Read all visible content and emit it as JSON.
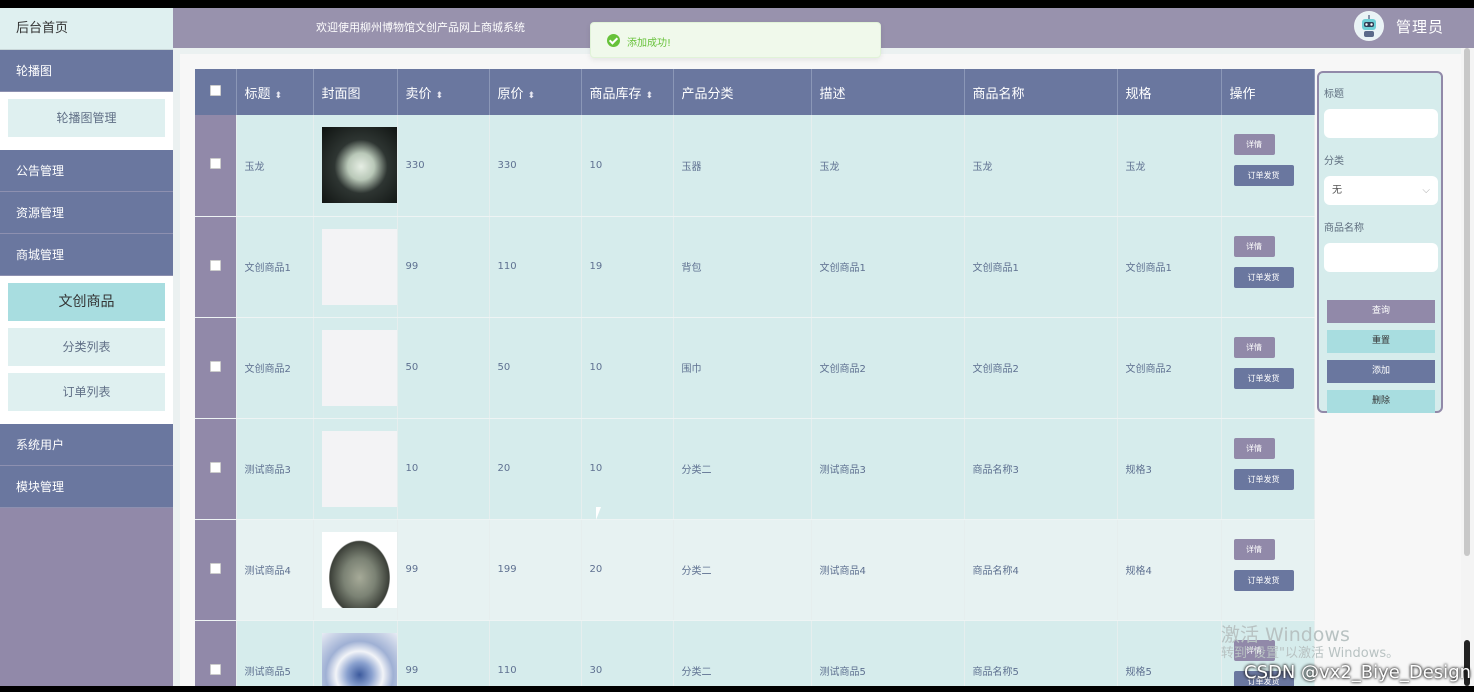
{
  "sidebar": {
    "home": "后台首页",
    "menu1": "轮播图",
    "sub1": [
      "轮播图管理"
    ],
    "menu2": "公告管理",
    "menu3": "资源管理",
    "menu4": "商城管理",
    "sub4": [
      "文创商品",
      "分类列表",
      "订单列表"
    ],
    "menu5": "系统用户",
    "menu6": "模块管理"
  },
  "header": {
    "welcome": "欢迎使用柳州博物馆文创产品网上商城系统",
    "admin": "管理员"
  },
  "toast": {
    "message": "添加成功!"
  },
  "table": {
    "columns": [
      "标题",
      "封面图",
      "卖价",
      "原价",
      "商品库存",
      "产品分类",
      "描述",
      "商品名称",
      "规格",
      "操作"
    ],
    "sortable": [
      "标题",
      "卖价",
      "原价",
      "商品库存"
    ],
    "detail_label": "详情",
    "ship_label": "订单发货",
    "rows": [
      {
        "title": "玉龙",
        "price": "330",
        "orig": "330",
        "stock": "10",
        "cat": "玉器",
        "desc": "玉龙",
        "name": "玉龙",
        "spec": "玉龙",
        "img": "jade1"
      },
      {
        "title": "文创商品1",
        "price": "99",
        "orig": "110",
        "stock": "19",
        "cat": "背包",
        "desc": "文创商品1",
        "name": "文创商品1",
        "spec": "文创商品1",
        "img": "none"
      },
      {
        "title": "文创商品2",
        "price": "50",
        "orig": "50",
        "stock": "10",
        "cat": "围巾",
        "desc": "文创商品2",
        "name": "文创商品2",
        "spec": "文创商品2",
        "img": "none"
      },
      {
        "title": "测试商品3",
        "price": "10",
        "orig": "20",
        "stock": "10",
        "cat": "分类二",
        "desc": "测试商品3",
        "name": "商品名称3",
        "spec": "规格3",
        "img": "none"
      },
      {
        "title": "测试商品4",
        "price": "99",
        "orig": "199",
        "stock": "20",
        "cat": "分类二",
        "desc": "测试商品4",
        "name": "商品名称4",
        "spec": "规格4",
        "img": "jade2"
      },
      {
        "title": "测试商品5",
        "price": "99",
        "orig": "110",
        "stock": "30",
        "cat": "分类二",
        "desc": "测试商品5",
        "name": "商品名称5",
        "spec": "规格5",
        "img": "jade3"
      }
    ]
  },
  "search": {
    "title_label": "标题",
    "category_label": "分类",
    "category_value": "无",
    "name_label": "商品名称",
    "query": "查询",
    "reset": "重置",
    "add": "添加",
    "delete": "删除"
  },
  "watermark": {
    "win": "激活 Windows",
    "win_sub": "转到\"设置\"以激活 Windows。",
    "csdn": "CSDN @vx2_Biye_Design"
  },
  "colors": {
    "primary": "#6a779f",
    "secondary": "#9189a9",
    "accent": "#a8dde0",
    "success": "#67c23a"
  }
}
